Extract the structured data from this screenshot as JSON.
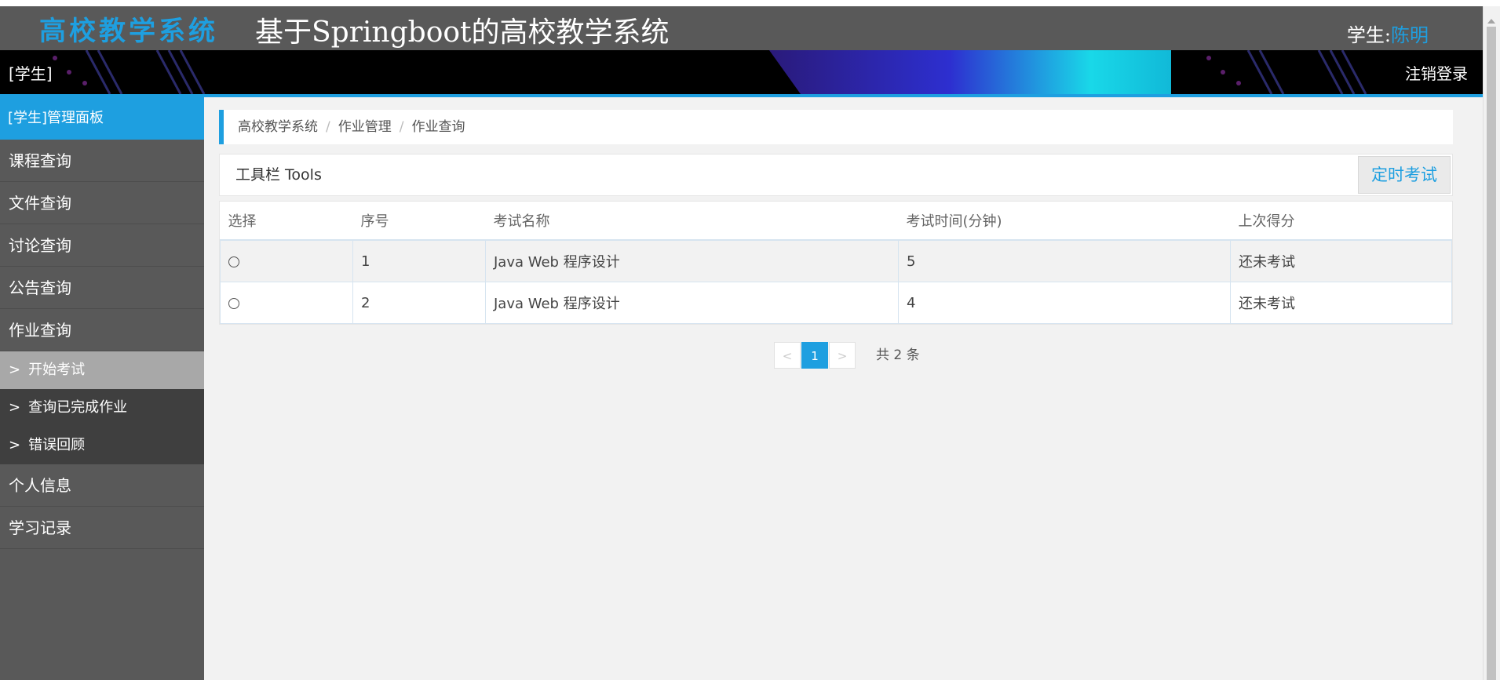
{
  "header": {
    "logo": "高校教学系统",
    "title": "基于Springboot的高校教学系统",
    "user_label": "学生:",
    "user_name": "陈明"
  },
  "banner": {
    "role": "[学生]",
    "logout": "注销登录"
  },
  "sidebar": {
    "header": "[学生]管理面板",
    "items": [
      {
        "label": "课程查询"
      },
      {
        "label": "文件查询"
      },
      {
        "label": "讨论查询"
      },
      {
        "label": "公告查询"
      },
      {
        "label": "作业查询"
      }
    ],
    "sub_items": [
      {
        "label": "开始考试",
        "active": true
      },
      {
        "label": "查询已完成作业"
      },
      {
        "label": "错误回顾"
      }
    ],
    "bottom_items": [
      {
        "label": "个人信息"
      },
      {
        "label": "学习记录"
      }
    ]
  },
  "breadcrumb": [
    "高校教学系统",
    "作业管理",
    "作业查询"
  ],
  "toolbar": {
    "title": "工具栏 Tools",
    "timed_exam_button": "定时考试"
  },
  "table": {
    "headers": [
      "选择",
      "序号",
      "考试名称",
      "考试时间(分钟)",
      "上次得分"
    ],
    "rows": [
      {
        "index": "1",
        "name": "Java Web 程序设计",
        "minutes": "5",
        "score": "还未考试"
      },
      {
        "index": "2",
        "name": "Java Web 程序设计",
        "minutes": "4",
        "score": "还未考试"
      }
    ]
  },
  "pagination": {
    "prev": "<",
    "current": "1",
    "next": ">",
    "total_text": "共 2 条"
  },
  "colors": {
    "accent": "#1e9fe0",
    "sidebar_bg": "#595959",
    "header_bg": "#595959"
  }
}
